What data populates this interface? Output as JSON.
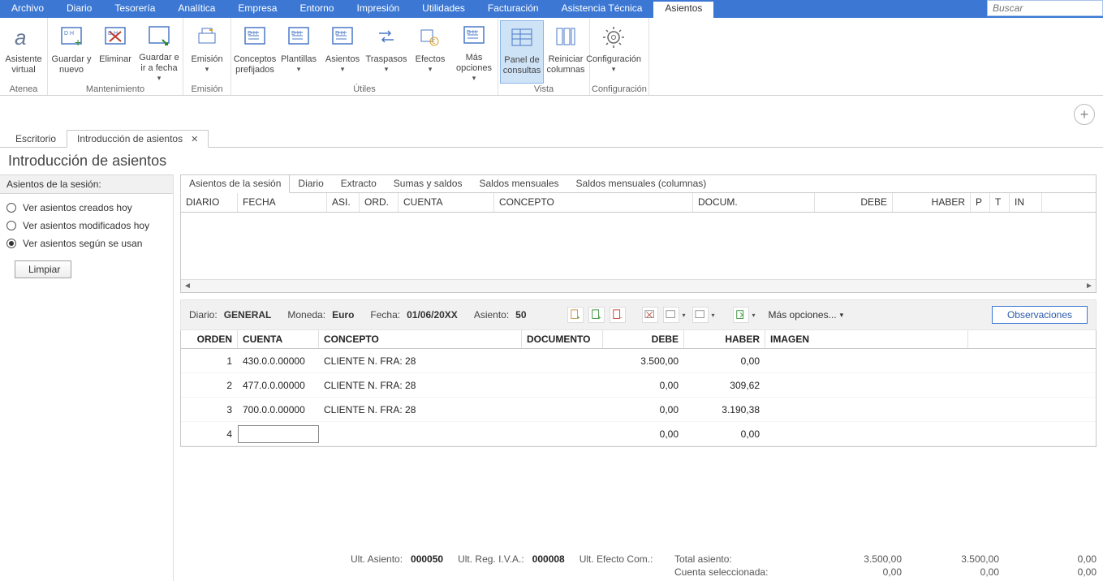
{
  "menu": {
    "items": [
      "Archivo",
      "Diario",
      "Tesorería",
      "Analítica",
      "Empresa",
      "Entorno",
      "Impresión",
      "Utilidades",
      "Facturación",
      "Asistencia Técnica",
      "Asientos"
    ],
    "active": "Asientos",
    "search_placeholder": "Buscar"
  },
  "ribbon": {
    "groups": [
      {
        "label": "Atenea",
        "buttons": [
          {
            "name": "asistente-virtual",
            "label": "Asistente virtual",
            "icon": "alpha"
          }
        ]
      },
      {
        "label": "Mantenimiento",
        "buttons": [
          {
            "name": "guardar-nuevo",
            "label": "Guardar y nuevo",
            "icon": "save-new"
          },
          {
            "name": "eliminar",
            "label": "Eliminar",
            "icon": "delete"
          },
          {
            "name": "guardar-ir-fecha",
            "label": "Guardar e ir a fecha",
            "icon": "save-date",
            "menu": true
          }
        ]
      },
      {
        "label": "Emisión",
        "buttons": [
          {
            "name": "emision",
            "label": "Emisión",
            "icon": "print",
            "menu": true
          }
        ]
      },
      {
        "label": "Útiles",
        "buttons": [
          {
            "name": "conceptos-prefijados",
            "label": "Conceptos prefijados",
            "icon": "doc"
          },
          {
            "name": "plantillas",
            "label": "Plantillas",
            "icon": "doc",
            "menu": true
          },
          {
            "name": "asientos-util",
            "label": "Asientos",
            "icon": "doc",
            "menu": true
          },
          {
            "name": "traspasos",
            "label": "Traspasos",
            "icon": "swap",
            "menu": true
          },
          {
            "name": "efectos",
            "label": "Efectos",
            "icon": "effects",
            "menu": true
          },
          {
            "name": "mas-opciones",
            "label": "Más opciones",
            "icon": "doc",
            "menu": true
          }
        ]
      },
      {
        "label": "Vista",
        "buttons": [
          {
            "name": "panel-consultas",
            "label": "Panel de consultas",
            "icon": "panelq",
            "active": true
          },
          {
            "name": "reiniciar-columnas",
            "label": "Reiniciar columnas",
            "icon": "columns"
          }
        ]
      },
      {
        "label": "Configuración",
        "buttons": [
          {
            "name": "configuracion",
            "label": "Configuración",
            "icon": "gear",
            "menu": true
          }
        ]
      }
    ]
  },
  "doc_tabs": [
    {
      "label": "Escritorio",
      "active": false
    },
    {
      "label": "Introducción de asientos",
      "active": true,
      "closable": true
    }
  ],
  "page_title": "Introducción de asientos",
  "side": {
    "header": "Asientos de la sesión:",
    "options": [
      {
        "label": "Ver asientos creados hoy",
        "checked": false
      },
      {
        "label": "Ver asientos modificados hoy",
        "checked": false
      },
      {
        "label": "Ver asientos según se usan",
        "checked": true
      }
    ],
    "clear_btn": "Limpiar"
  },
  "query_tabs": [
    "Asientos de la sesión",
    "Diario",
    "Extracto",
    "Sumas y saldos",
    "Saldos mensuales",
    "Saldos mensuales (columnas)"
  ],
  "upper_grid_cols": [
    "DIARIO",
    "FECHA",
    "ASI.",
    "ORD.",
    "CUENTA",
    "CONCEPTO",
    "DOCUM.",
    "DEBE",
    "HABER",
    "P",
    "T",
    "IN"
  ],
  "info": {
    "diario_label": "Diario:",
    "diario_val": "GENERAL",
    "moneda_label": "Moneda:",
    "moneda_val": "Euro",
    "fecha_label": "Fecha:",
    "fecha_val": "01/06/20XX",
    "asiento_label": "Asiento:",
    "asiento_val": "50",
    "more_label": "Más opciones...",
    "obs_btn": "Observaciones"
  },
  "entry_cols": [
    "ORDEN",
    "CUENTA",
    "CONCEPTO",
    "DOCUMENTO",
    "DEBE",
    "HABER",
    "IMAGEN"
  ],
  "entries": [
    {
      "orden": "1",
      "cuenta": "430.0.0.00000",
      "concepto": "CLIENTE N. FRA:  28",
      "documento": "",
      "debe": "3.500,00",
      "haber": "0,00"
    },
    {
      "orden": "2",
      "cuenta": "477.0.0.00000",
      "concepto": "CLIENTE N. FRA:  28",
      "documento": "",
      "debe": "0,00",
      "haber": "309,62"
    },
    {
      "orden": "3",
      "cuenta": "700.0.0.00000",
      "concepto": "CLIENTE N. FRA:  28",
      "documento": "",
      "debe": "0,00",
      "haber": "3.190,38"
    },
    {
      "orden": "4",
      "cuenta": "",
      "concepto": "",
      "documento": "",
      "debe": "0,00",
      "haber": "0,00",
      "editing": true
    }
  ],
  "footer": {
    "ult_asiento_label": "Ult. Asiento:",
    "ult_asiento_val": "000050",
    "ult_iva_label": "Ult. Reg. I.V.A.:",
    "ult_iva_val": "000008",
    "ult_efecto_label": "Ult. Efecto Com.:",
    "total_label": "Total asiento:",
    "sel_label": "Cuenta seleccionada:",
    "total_debe": "3.500,00",
    "total_haber": "3.500,00",
    "total_saldo": "0,00",
    "sel_debe": "0,00",
    "sel_haber": "0,00",
    "sel_saldo": "0,00"
  }
}
